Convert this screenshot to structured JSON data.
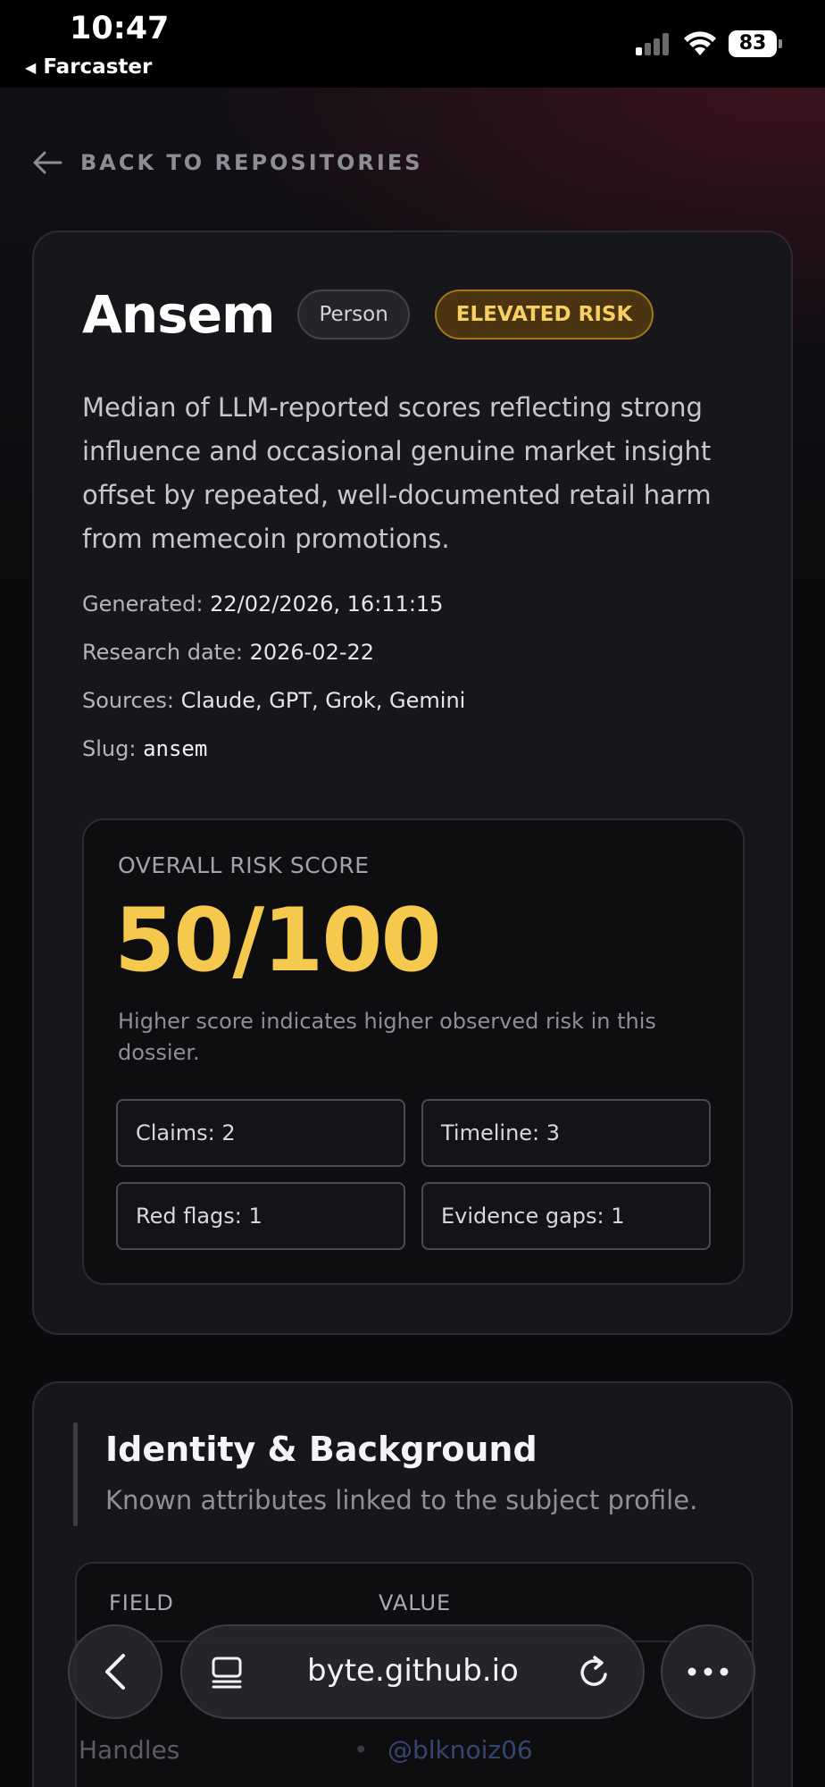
{
  "status_bar": {
    "time": "10:47",
    "back_app": "Farcaster",
    "battery": "83"
  },
  "back_link": {
    "label": "BACK TO REPOSITORIES"
  },
  "subject": {
    "name": "Ansem",
    "type_badge": "Person",
    "risk_badge": "ELEVATED RISK",
    "summary": "Median of LLM-reported scores reflecting strong influence and occasional genuine market insight offset by repeated, well-documented retail harm from memecoin promotions."
  },
  "meta": {
    "generated_label": "Generated:",
    "generated_value": "22/02/2026, 16:11:15",
    "research_label": "Research date:",
    "research_value": "2026-02-22",
    "sources_label": "Sources:",
    "sources_value": "Claude, GPT, Grok, Gemini",
    "slug_label": "Slug:",
    "slug_value": "ansem"
  },
  "score": {
    "label": "OVERALL RISK SCORE",
    "value": "50/100",
    "note": "Higher score indicates higher observed risk in this dossier.",
    "stats": {
      "claims": "Claims: 2",
      "timeline": "Timeline: 3",
      "red_flags": "Red flags: 1",
      "evidence_gaps": "Evidence gaps: 1"
    }
  },
  "identity": {
    "title": "Identity & Background",
    "subtitle": "Known attributes linked to the subject profile.",
    "columns": {
      "field": "FIELD",
      "value": "VALUE"
    },
    "rows": [
      {
        "field": "Handles",
        "value": "@blknoiz06"
      }
    ]
  },
  "browser": {
    "url": "byte.github.io"
  },
  "colors": {
    "accent_score": "#f5c94d",
    "risk_badge_bg": "#4b3411",
    "risk_badge_text": "#f7cf62"
  }
}
